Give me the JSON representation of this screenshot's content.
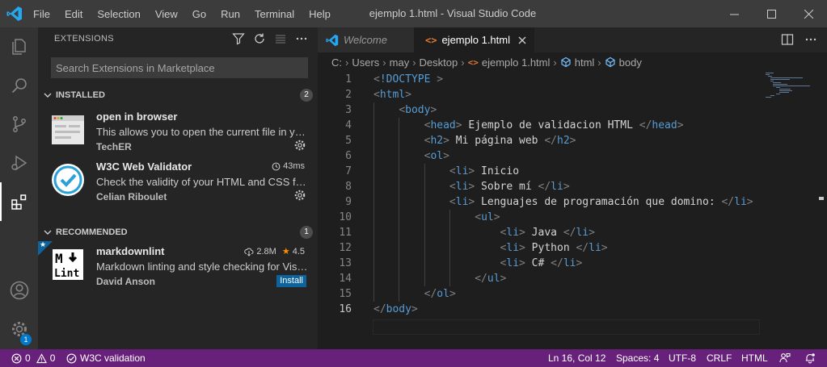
{
  "window": {
    "title": "ejemplo 1.html - Visual Studio Code",
    "menu": [
      "File",
      "Edit",
      "Selection",
      "View",
      "Go",
      "Run",
      "Terminal",
      "Help"
    ]
  },
  "activity_bar": {
    "items": [
      "explorer-icon",
      "search-icon",
      "source-control-icon",
      "run-debug-icon",
      "extensions-icon",
      "account-icon",
      "manage-gear-icon"
    ],
    "active": "extensions-icon",
    "manage_badge": "1"
  },
  "sidebar": {
    "title": "EXTENSIONS",
    "search_placeholder": "Search Extensions in Marketplace",
    "installed": {
      "label": "INSTALLED",
      "count": "2",
      "items": [
        {
          "name": "open in browser",
          "description": "This allows you to open the current file in your default browser",
          "publisher": "TechER"
        },
        {
          "name": "W3C Web Validator",
          "description": "Check the validity of your HTML and CSS files",
          "publisher": "Celian Riboulet",
          "activation_time": "43ms"
        }
      ]
    },
    "recommended": {
      "label": "RECOMMENDED",
      "count": "1",
      "items": [
        {
          "name": "markdownlint",
          "description": "Markdown linting and style checking for Visual Studio Code",
          "publisher": "David Anson",
          "downloads": "2.8M",
          "rating": "4.5",
          "install_label": "Install"
        }
      ]
    }
  },
  "editor": {
    "tabs": [
      {
        "label": "Welcome",
        "active": false
      },
      {
        "label": "ejemplo 1.html",
        "active": true
      }
    ],
    "breadcrumb": [
      "C:",
      "Users",
      "may",
      "Desktop",
      "ejemplo 1.html",
      "html",
      "body"
    ],
    "lines": [
      {
        "n": "1",
        "text": "<!DOCTYPE >"
      },
      {
        "n": "2",
        "text": "<html>"
      },
      {
        "n": "3",
        "text": "    <body>"
      },
      {
        "n": "4",
        "text": "        <head> Ejemplo de validacion HTML </head>"
      },
      {
        "n": "5",
        "text": "        <h2> Mi página web </h2>"
      },
      {
        "n": "6",
        "text": "        <ol>"
      },
      {
        "n": "7",
        "text": "            <li> Inicio"
      },
      {
        "n": "8",
        "text": "            <li> Sobre mí </li>"
      },
      {
        "n": "9",
        "text": "            <li> Lenguajes de programación que domino: </li>"
      },
      {
        "n": "10",
        "text": "                <ul>"
      },
      {
        "n": "11",
        "text": "                    <li> Java </li>"
      },
      {
        "n": "12",
        "text": "                    <li> Python </li>"
      },
      {
        "n": "13",
        "text": "                    <li> C# </li>"
      },
      {
        "n": "14",
        "text": "                </ul>"
      },
      {
        "n": "15",
        "text": "        </ol>"
      },
      {
        "n": "16",
        "text": "</body>"
      }
    ],
    "current_line": "16"
  },
  "status_bar": {
    "errors": "0",
    "warnings": "0",
    "w3c": "W3C validation",
    "position": "Ln 16, Col 12",
    "spaces": "Spaces: 4",
    "encoding": "UTF-8",
    "eol": "CRLF",
    "language": "HTML",
    "color": "#68217a"
  }
}
